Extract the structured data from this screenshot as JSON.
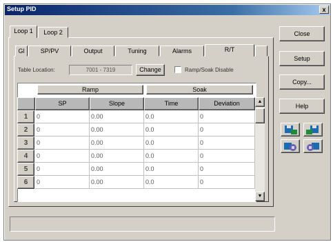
{
  "window": {
    "title": "Setup PID",
    "close_glyph": "x"
  },
  "outer_tabs": [
    {
      "label": "Loop 1"
    },
    {
      "label": "Loop 2"
    }
  ],
  "inner_tabs": [
    {
      "label": "Gl"
    },
    {
      "label": "SP/PV"
    },
    {
      "label": "Output"
    },
    {
      "label": "Tuning"
    },
    {
      "label": "Alarms"
    },
    {
      "label": "R/T"
    }
  ],
  "table_location": {
    "label": "Table Location:",
    "value": "7001 - 7319",
    "change_label": "Change"
  },
  "ramp_soak_disable": {
    "label": "Ramp/Soak Disable",
    "checked": false
  },
  "grid": {
    "groups": [
      {
        "label": "Ramp"
      },
      {
        "label": "Soak"
      }
    ],
    "columns": [
      "SP",
      "Slope",
      "Time",
      "Deviation"
    ],
    "rows": [
      {
        "num": "1",
        "cells": [
          "0",
          "0.00",
          "0.0",
          "0"
        ]
      },
      {
        "num": "2",
        "cells": [
          "0",
          "0.00",
          "0.0",
          "0"
        ]
      },
      {
        "num": "3",
        "cells": [
          "0",
          "0.00",
          "0.0",
          "0"
        ]
      },
      {
        "num": "4",
        "cells": [
          "0",
          "0.00",
          "0.0",
          "0"
        ]
      },
      {
        "num": "5",
        "cells": [
          "0",
          "0.00",
          "0.0",
          "0"
        ]
      },
      {
        "num": "6",
        "cells": [
          "0",
          "0.00",
          "0.0",
          "0"
        ]
      }
    ]
  },
  "side_buttons": {
    "close": "Close",
    "setup": "Setup",
    "copy": "Copy...",
    "help": "Help"
  },
  "icon_buttons": [
    "export-left-icon",
    "export-right-icon",
    "import-left-icon",
    "import-right-icon"
  ],
  "colors": {
    "title_gradient_start": "#0a246a",
    "face": "#d4d0c8",
    "header_gray": "#b8b8b8"
  }
}
